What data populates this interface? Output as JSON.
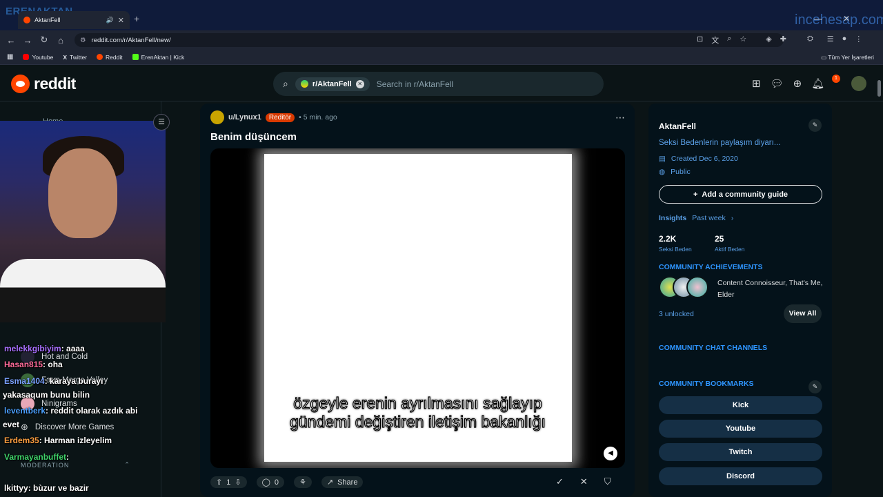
{
  "browser": {
    "tab_title": "AktanFell",
    "url": "reddit.com/r/AktanFell/new/",
    "bookmarks": [
      {
        "label": "Youtube",
        "color": "#ff0000"
      },
      {
        "label": "Twitter",
        "color": "#ffffff"
      },
      {
        "label": "Reddit",
        "color": "#ff4500"
      },
      {
        "label": "ErenAktan | Kick",
        "color": "#53fc18"
      }
    ],
    "all_bookmarks": "Tüm Yer İşaretleri"
  },
  "overlay": {
    "streamer_watermark": "ERENAKTAN",
    "site_watermark": "incehesap.com"
  },
  "header": {
    "logo_text": "reddit",
    "search_chip": "r/AktanFell",
    "search_placeholder": "Search in r/AktanFell",
    "notification_count": "1"
  },
  "sidebar": {
    "home_label": "Home",
    "games": [
      "Hot and Cold",
      "Farm Merge Valley",
      "Ninigrams",
      "Discover More Games"
    ],
    "moderation_label": "MODERATION"
  },
  "chat": [
    {
      "user": "melekkgibiyim",
      "msg": ": aaaa",
      "color": "#a970ff"
    },
    {
      "user": "Hasan815",
      "msg": ": oha",
      "color": "#ff6b9a"
    },
    {
      "user": "Esma1404",
      "msg": ": karaya burayı",
      "color": "#7aa2ff"
    },
    {
      "user": "",
      "msg": "yakasaqum bunu bilin",
      "color": "#ffffff"
    },
    {
      "user": "leventberk",
      "msg": ": reddit olarak azdık abi",
      "color": "#4aa0ff"
    },
    {
      "user": "",
      "msg": "evet",
      "color": "#ffffff"
    },
    {
      "user": "Erdem35",
      "msg": ": Harman izleyelim",
      "color": "#ff9f40"
    },
    {
      "user": "Varmayanbuffet",
      "msg": ":",
      "color": "#3fd36a"
    },
    {
      "user": "lkittyy",
      "msg": ": bùzur ve bazir",
      "color": "#ffffff"
    }
  ],
  "post": {
    "username": "u/Lynux1",
    "flair": "Reditör",
    "time": "• 5 min. ago",
    "title": "Benim düşüncem",
    "caption_line1": "özgeyle erenin ayrılmasını sağlayıp",
    "caption_line2": "gündemi değiştiren iletişim bakanlığı",
    "votes": "1",
    "comments": "0",
    "share_label": "Share"
  },
  "community": {
    "name": "AktanFell",
    "description": "Seksi Bedenlerin paylaşım diyarı...",
    "created": "Created Dec 6, 2020",
    "visibility": "Public",
    "guide_button": "Add a community guide",
    "insights_label": "Insights",
    "insights_period": "Past week",
    "stats": [
      {
        "value": "2.2K",
        "label": "Seksi Beden"
      },
      {
        "value": "25",
        "label": "Aktif Beden"
      }
    ],
    "achievements_title": "COMMUNITY ACHIEVEMENTS",
    "achievements_text": "Content Connoisseur, That's Me, Elder",
    "unlocked": "3 unlocked",
    "view_all": "View All",
    "chat_channels_title": "COMMUNITY CHAT CHANNELS",
    "bookmarks_title": "COMMUNITY BOOKMARKS",
    "bookmark_buttons": [
      "Kick",
      "Youtube",
      "Twitch",
      "Discord"
    ]
  }
}
